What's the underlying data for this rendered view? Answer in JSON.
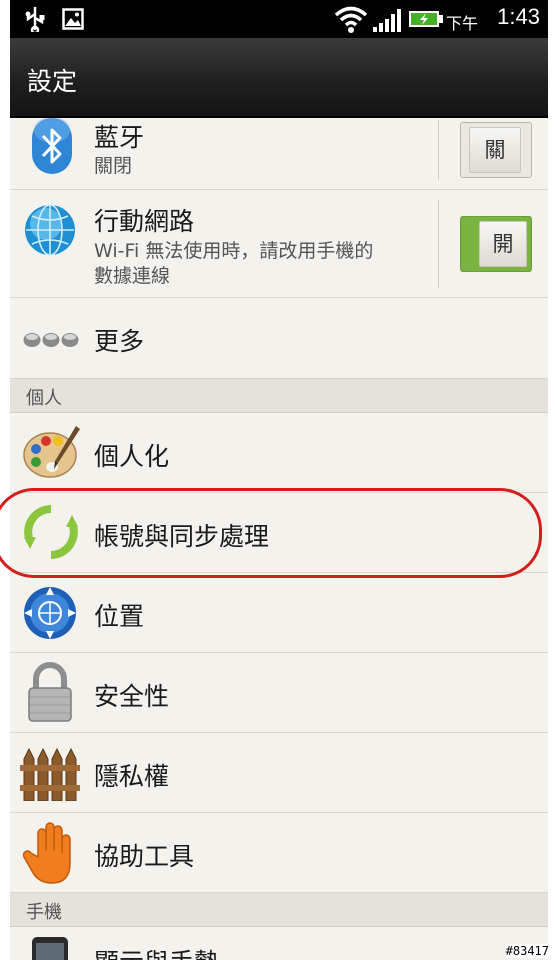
{
  "status_bar": {
    "ampm": "下午",
    "time": "1:43",
    "icons": [
      "usb-icon",
      "image-icon",
      "wifi-icon",
      "signal-icon",
      "battery-charging-icon"
    ]
  },
  "title": "設定",
  "rows": {
    "bluetooth": {
      "label": "藍牙",
      "sub": "關閉",
      "toggle": "關",
      "icon": "bluetooth-icon"
    },
    "mobile_network": {
      "label": "行動網路",
      "sub_line1": "Wi-Fi 無法使用時，請改用手機的",
      "sub_line2": "數據連線",
      "toggle": "開",
      "icon": "globe-icon"
    },
    "more": {
      "label": "更多",
      "icon": "more-dots-icon"
    },
    "personalize": {
      "label": "個人化",
      "icon": "palette-icon"
    },
    "accounts_sync": {
      "label": "帳號與同步處理",
      "icon": "sync-icon"
    },
    "location": {
      "label": "位置",
      "icon": "location-compass-icon"
    },
    "security": {
      "label": "安全性",
      "icon": "lock-icon"
    },
    "privacy": {
      "label": "隱私權",
      "icon": "fence-icon"
    },
    "accessibility": {
      "label": "協助工具",
      "icon": "hand-icon"
    },
    "display_gestures": {
      "label": "顯示與手勢",
      "icon": "phone-icon"
    }
  },
  "sections": {
    "personal": "個人",
    "phone": "手機"
  },
  "watermark": "#83417",
  "colors": {
    "toggle_on": "#7ab33f",
    "highlight_ring": "#d41e1e"
  }
}
